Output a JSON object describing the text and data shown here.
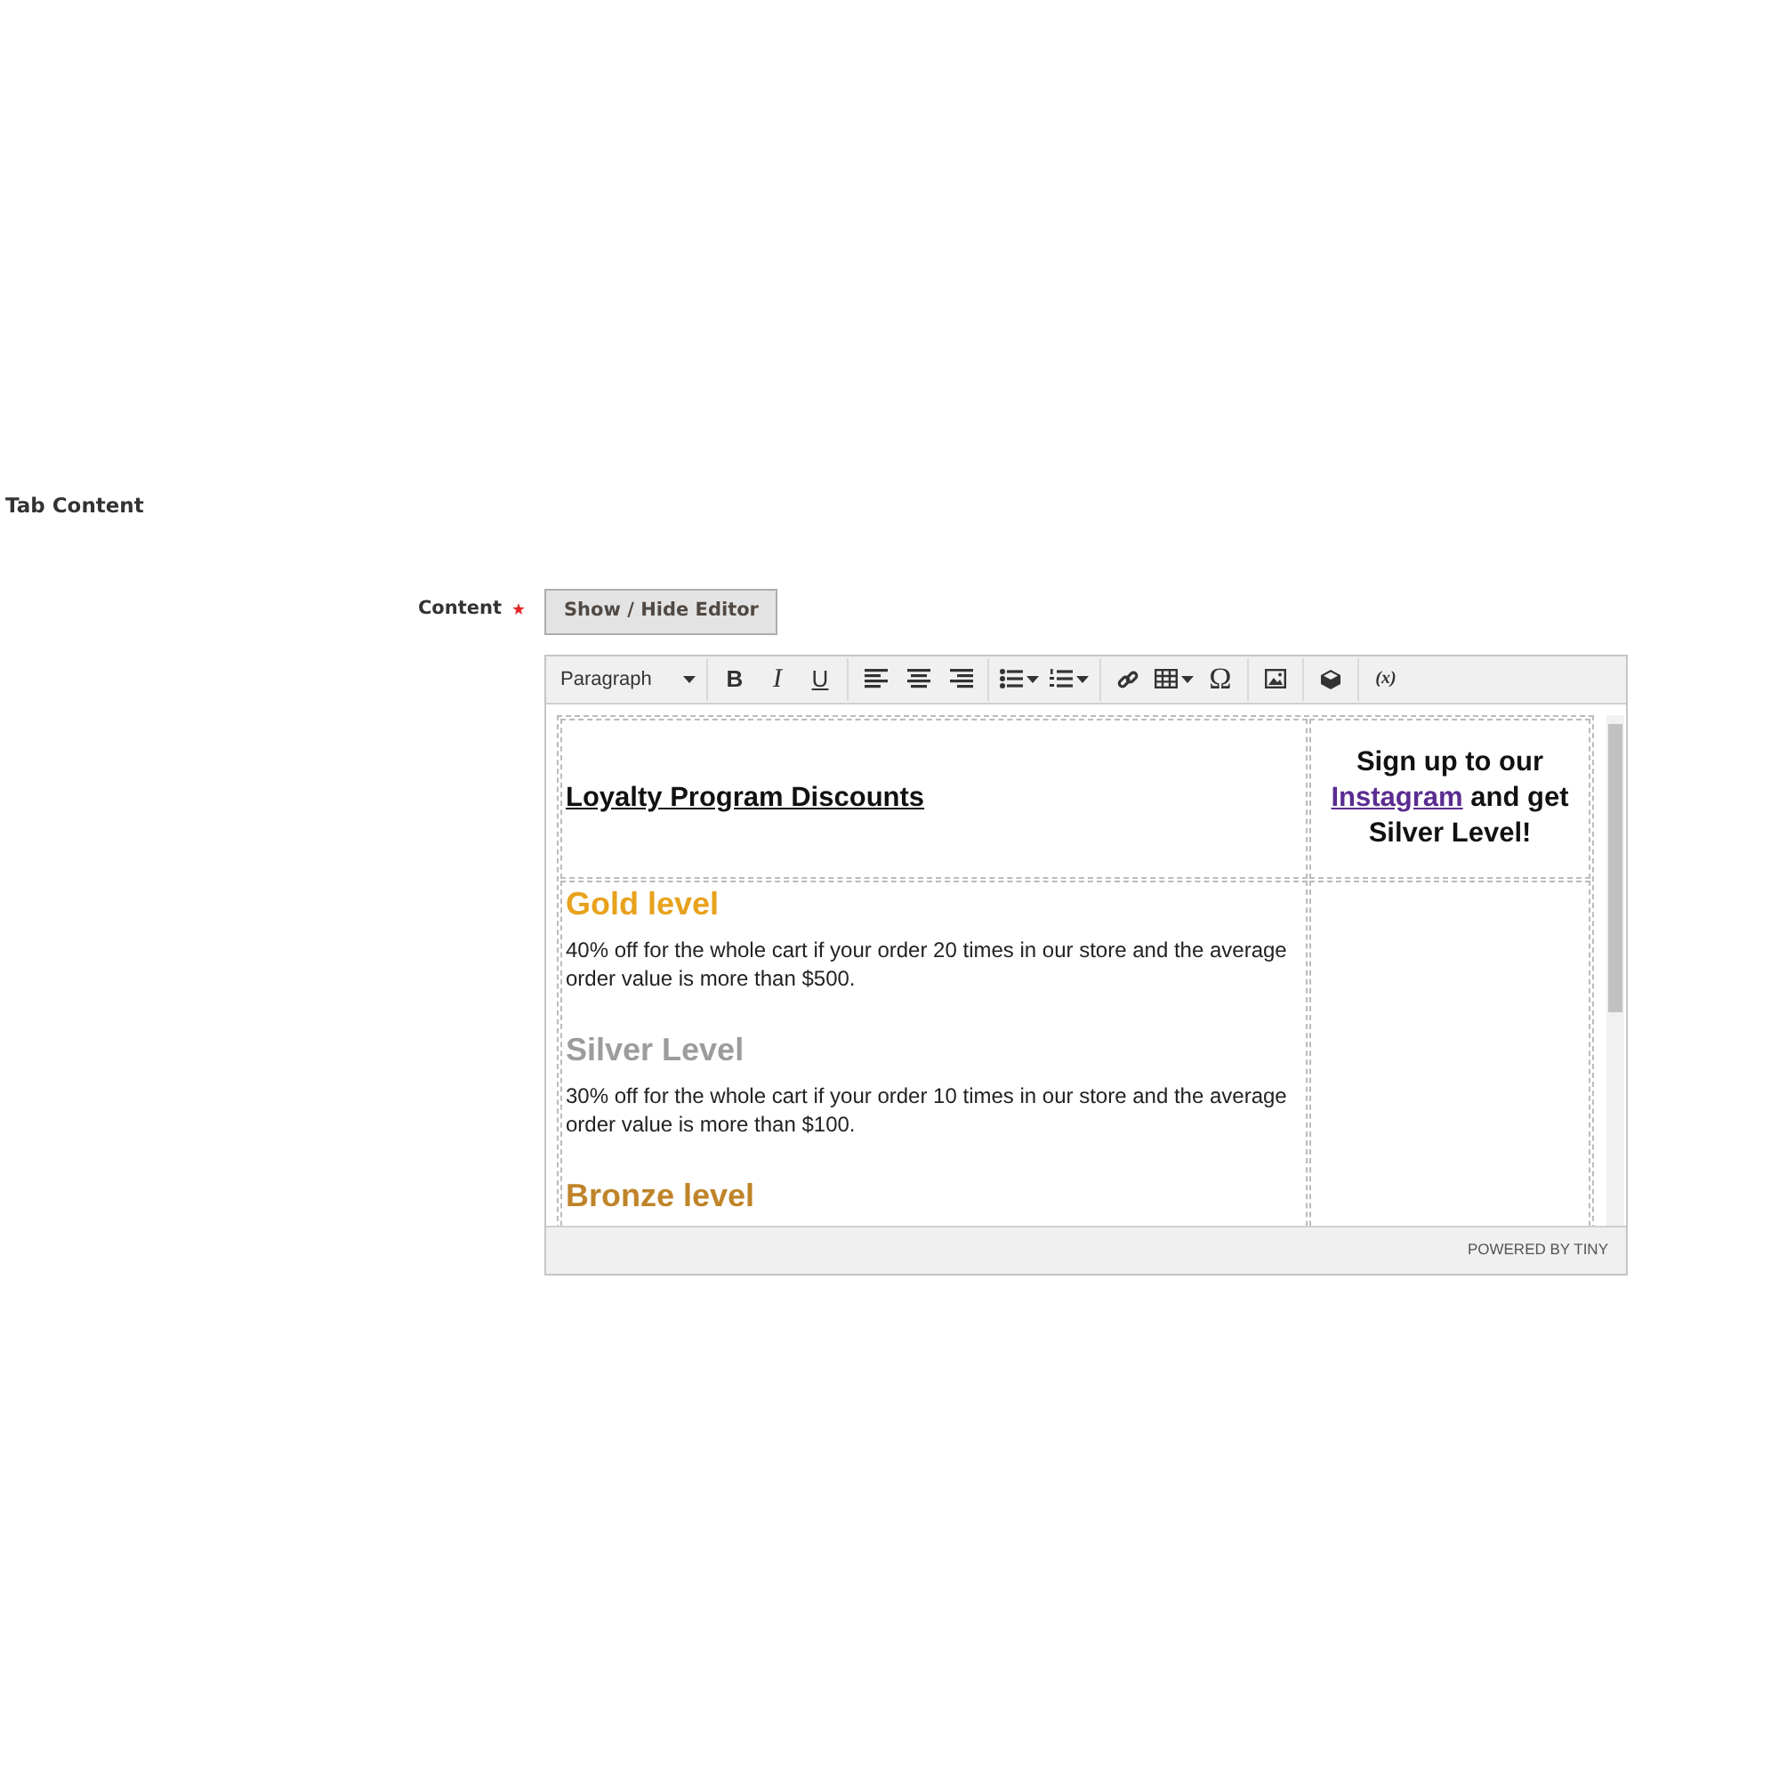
{
  "section_title": "Tab Content",
  "field": {
    "label": "Content",
    "required": true,
    "toggle_button": "Show / Hide Editor"
  },
  "toolbar": {
    "format": "Paragraph",
    "groups": [
      [
        {
          "kind": "bold",
          "label": "B"
        },
        {
          "kind": "italic",
          "label": "I"
        },
        {
          "kind": "underline",
          "label": "U"
        }
      ],
      [
        {
          "kind": "align-left"
        },
        {
          "kind": "align-center"
        },
        {
          "kind": "align-right"
        }
      ],
      [
        {
          "kind": "bullet-list",
          "dropdown": true
        },
        {
          "kind": "numbered-list",
          "dropdown": true
        }
      ],
      [
        {
          "kind": "link"
        },
        {
          "kind": "table",
          "dropdown": true
        },
        {
          "kind": "symbol",
          "label": "Ω"
        }
      ],
      [
        {
          "kind": "image"
        }
      ],
      [
        {
          "kind": "widget"
        }
      ],
      [
        {
          "kind": "variable",
          "label": "(x)"
        }
      ]
    ]
  },
  "content": {
    "title": "Loyalty Program Discounts",
    "promo": {
      "before": "Sign up to our",
      "link": "Instagram",
      "after": "and get Silver Level!"
    },
    "levels": [
      {
        "heading": "Gold level",
        "color": "#e8a21d",
        "text": "40% off for the whole cart if your order 20 times in our store and the average order value is more than $500."
      },
      {
        "heading": "Silver Level",
        "color": "#9c9c9c",
        "text": "30% off for the whole cart if your order 10 times in our store and the average order value is more than $100."
      },
      {
        "heading": "Bronze level",
        "color": "#bf8429"
      }
    ]
  },
  "status_bar": "POWERED BY TINY"
}
